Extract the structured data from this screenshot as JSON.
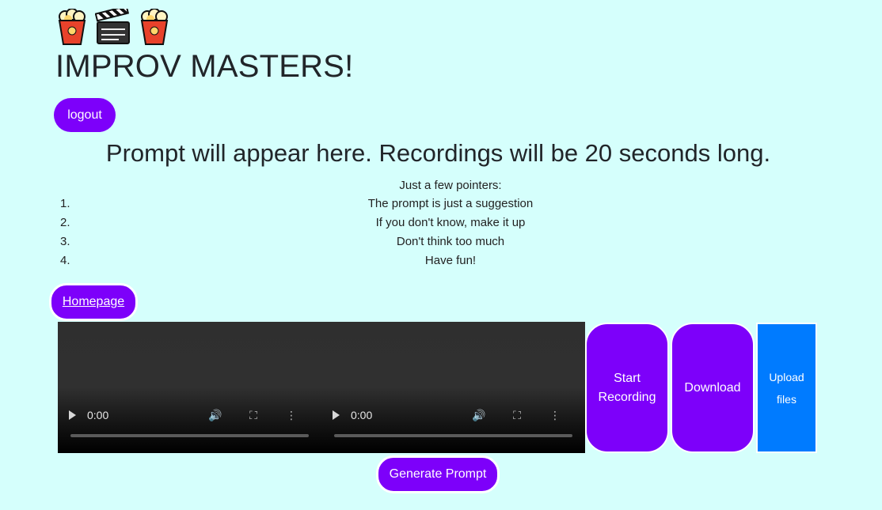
{
  "header": {
    "emojis": [
      "popcorn-icon",
      "clapper-board-icon",
      "popcorn-icon"
    ],
    "title": "IMPROV MASTERS!"
  },
  "nav": {
    "logout_label": "logout",
    "homepage_label": "Homepage"
  },
  "prompt": {
    "text": "Prompt will appear here. Recordings will be 20 seconds long."
  },
  "pointers": {
    "heading": "Just a few pointers:",
    "items": [
      {
        "num": "1.",
        "text": "The prompt is just a suggestion"
      },
      {
        "num": "2.",
        "text": "If you don't know, make it up"
      },
      {
        "num": "3.",
        "text": "Don't think too much"
      },
      {
        "num": "4.",
        "text": "Have fun!"
      }
    ]
  },
  "videos": [
    {
      "time": "0:00"
    },
    {
      "time": "0:00"
    }
  ],
  "controls": {
    "start_label": "Start Recording",
    "download_label": "Download",
    "upload_label": "Upload files",
    "generate_label": "Generate Prompt"
  },
  "colors": {
    "background": "#d5fffc",
    "button_purple": "#7d00fa",
    "button_blue": "#007bff"
  }
}
